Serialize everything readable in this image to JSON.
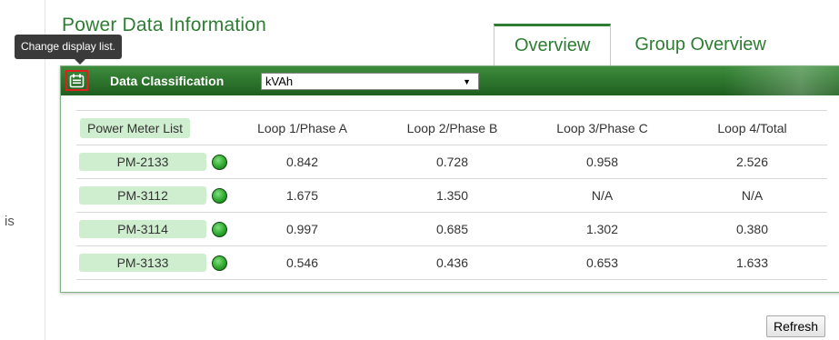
{
  "page": {
    "title": "Power Data Information",
    "left_fragment": "is"
  },
  "tooltip": {
    "text": "Change display list."
  },
  "tabs": [
    {
      "label": "Overview",
      "active": true
    },
    {
      "label": "Group Overview",
      "active": false
    }
  ],
  "panel": {
    "list_icon": "calendar-list-icon",
    "classification_label": "Data Classification",
    "classification_value": "kVAh",
    "dropdown_arrow": "▼"
  },
  "table": {
    "headers": [
      "Power Meter List",
      "Loop 1/Phase A",
      "Loop 2/Phase B",
      "Loop 3/Phase C",
      "Loop 4/Total"
    ],
    "rows": [
      {
        "meter": "PM-2133",
        "status": "online",
        "values": [
          "0.842",
          "0.728",
          "0.958",
          "2.526"
        ]
      },
      {
        "meter": "PM-3112",
        "status": "online",
        "values": [
          "1.675",
          "1.350",
          "N/A",
          "N/A"
        ]
      },
      {
        "meter": "PM-3114",
        "status": "online",
        "values": [
          "0.997",
          "0.685",
          "1.302",
          "0.380"
        ]
      },
      {
        "meter": "PM-3133",
        "status": "online",
        "values": [
          "0.546",
          "0.436",
          "0.653",
          "1.633"
        ]
      }
    ]
  },
  "actions": {
    "refresh_label": "Refresh"
  },
  "colors": {
    "accent_green": "#2e7d32",
    "header_green": "#2f7a2f",
    "meter_bg": "#cfeecf",
    "status_online": "#2ea82e",
    "highlight_red": "#e0201c"
  }
}
